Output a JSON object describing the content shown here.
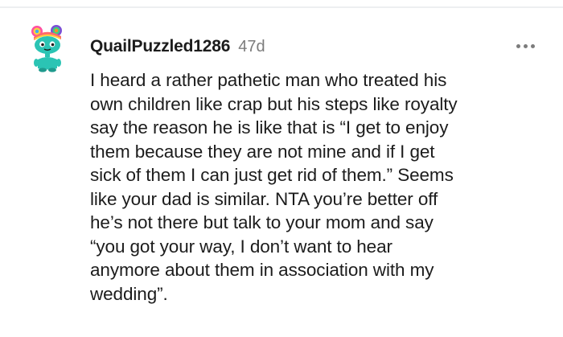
{
  "comment": {
    "author": "QuailPuzzled1286",
    "age": "47d",
    "more_icon": "more-horizontal-icon",
    "avatar_icon": "reddit-snoo-avatar-icon",
    "body_lines": [
      "I heard a rather pathetic man who treated his",
      "own children like crap but his steps like royalty",
      "say the reason he is like that is “I get to enjoy",
      "them because they are not mine and if I get",
      "sick of them I can just get rid of them.” Seems",
      "like your dad is similar. NTA you’re better off",
      "he’s not there but talk to your mom and say",
      "“you got your way, I don’t want to hear",
      "anymore about them in association with my",
      "wedding”."
    ]
  },
  "colors": {
    "text": "#1c1c1c",
    "meta": "#7c7c7c",
    "divider": "#edeff1",
    "avatar_face": "#2bc4b4"
  }
}
